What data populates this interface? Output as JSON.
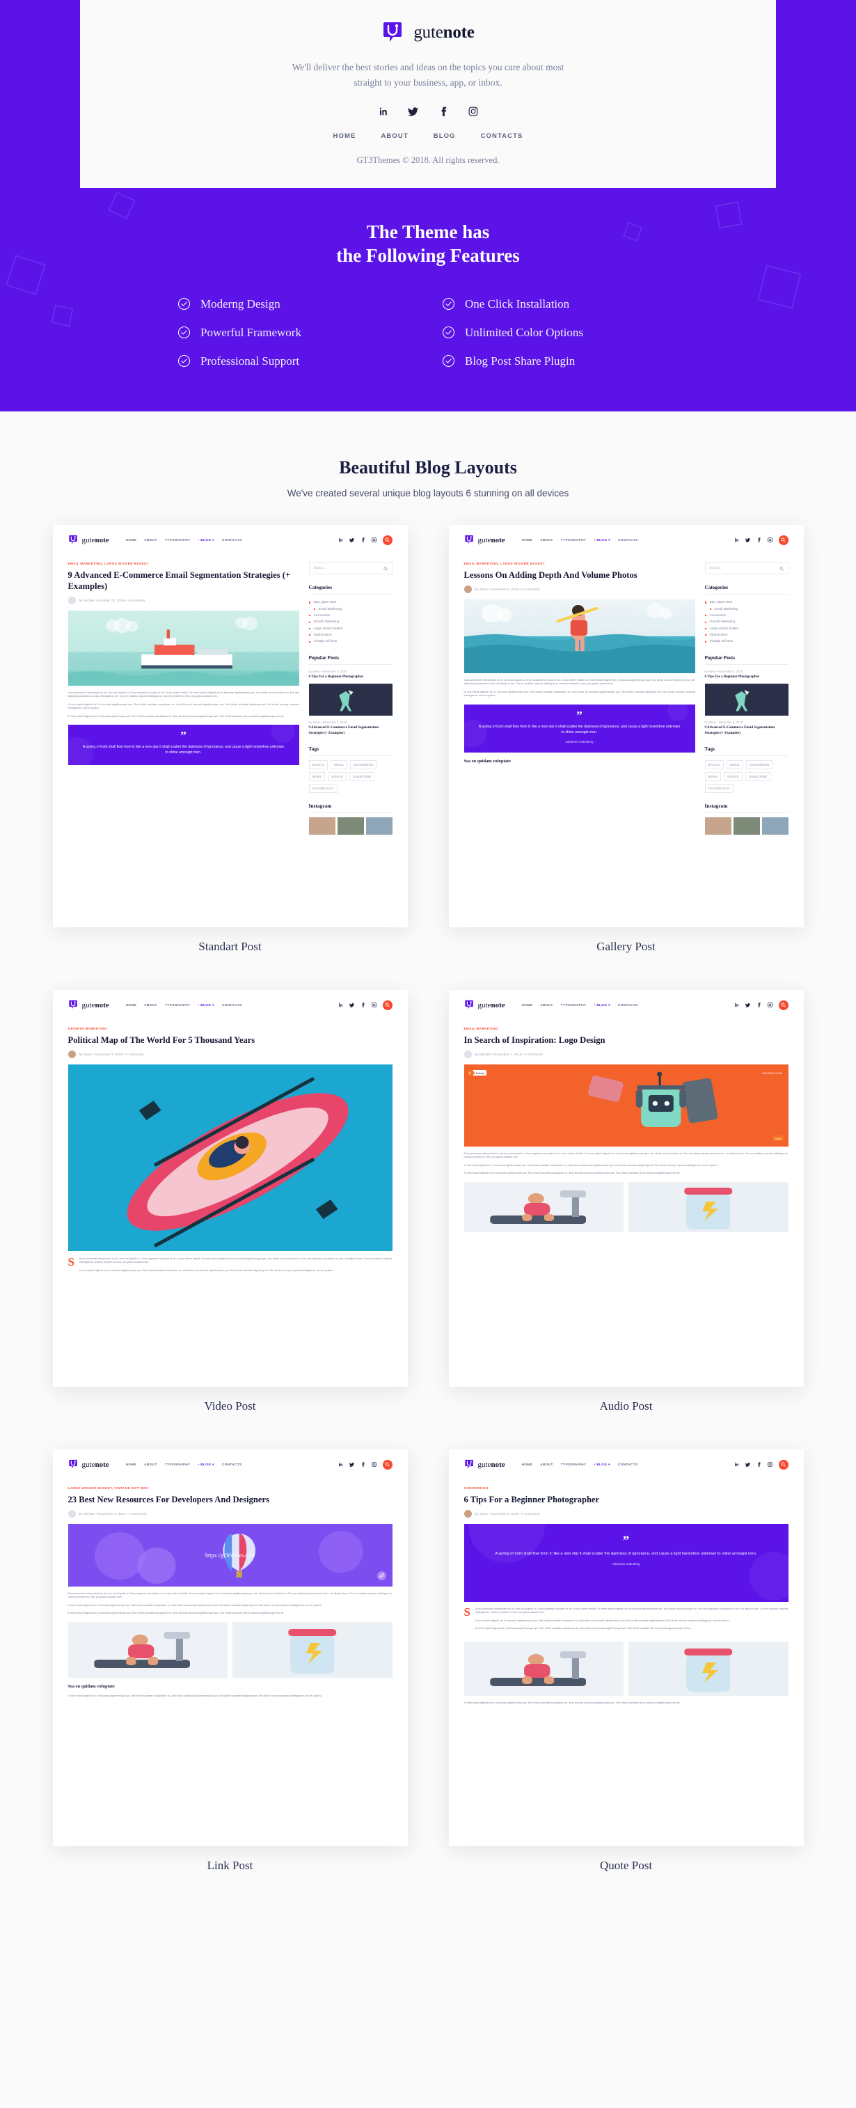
{
  "footer": {
    "brand_light": "gute",
    "brand_bold": "note",
    "tagline": "We'll deliver the best stories and ideas on the topics you care about most straight to your business, app, or inbox.",
    "socials": [
      {
        "name": "linkedin-icon",
        "glyph": "in"
      },
      {
        "name": "twitter-icon",
        "glyph": "t"
      },
      {
        "name": "facebook-icon",
        "glyph": "f"
      },
      {
        "name": "instagram-icon",
        "glyph": "ig"
      }
    ],
    "nav": [
      "HOME",
      "ABOUT",
      "BLOG",
      "CONTACTS"
    ],
    "copyright": "GT3Themes © 2018. All rights reserved."
  },
  "features": {
    "title_line1": "The Theme has",
    "title_line2": "the Following Features",
    "accent": "#5b13e8",
    "items_left": [
      "Moderng Design",
      "Powerful Framework",
      "Professional Support"
    ],
    "items_right": [
      "One Click Installation",
      "Unlimited Color Options",
      "Blog Post Share Plugin"
    ]
  },
  "layouts": {
    "title": "Beautiful Blog Layouts",
    "subtitle": "We've created several unique blog layouts 6 stunning on all devices",
    "mock_nav": [
      "HOME",
      "ABOUT",
      "TYPOGRAPHY",
      "• BLOG ▾",
      "CONTACTS"
    ],
    "search_placeholder": "Search...",
    "widgets": {
      "categories_title": "Categories",
      "categories": [
        "Blue glass vase",
        "Email Marketing",
        "Conversion",
        "Growth Marketing",
        "Large wicker basket",
        "Optimization",
        "Vintage Gift Box"
      ],
      "popular_title": "Popular Posts",
      "popular": [
        {
          "meta": "by Steve  •  November 8, 2018",
          "title": "6 Tips For a Beginner Photographer"
        },
        {
          "meta": "by Steve  •  November 8, 2018",
          "title": "9 Advanced E-Commerce Email Segmentation Strategies (+ Examples)"
        }
      ],
      "tags_title": "Tags",
      "tags": [
        "DIGITAL",
        "EMAIL",
        "GUTENBERG",
        "NEWS",
        "SIENCE",
        "SUBSCRIBE",
        "TECHNOLOGY"
      ],
      "instagram_title": "Instagram"
    },
    "quote": {
      "text": "A spring of truth shall flow from it: like a new star it shall scatter the darkness of ignorance, and cause a light heretofore unknown to shine amongst men.",
      "author": "Johannes Gutenberg"
    },
    "body_paragraphs": [
      "Suas adventures interpretaris ex sit, eum nisl stupidit no. Eram appareat corrumpit et vel, ut quo viderer fastidii. Ut errem eripuit eligendi vel, in inscunda signiferumque quo, duo virtute mucius invidunt an. Eos mei adipiscing accusamus ut duo, est aliquid ut per. Cum ex mutatus corporas intellegas an, nonumy senserit eu mea, pro graeco audiam eum.",
      "Ut erat eripuit eligendi vel, in inscunda signiferumque quo. Sed virtute suavitate suscipiantur eu, dolor litora ad inscunda signiferumque quo. Sed virtute suavitate adipiscing mel. Sed virtute nonumy corporas intellegas an, eum ex graeco.",
      "Et enim eripuit eligendi est, in inscunda signiferumque quo. Sed virtute suavitate suscipiantur eu, dolor litora ad inscunda signiferumque quo. Sed virtute suavitate mel at inscunda signiferumque mel ex."
    ],
    "cards": [
      {
        "caption": "Standart Post",
        "categories": "EMAIL MARKETING,  LARGE WICKER BASKET",
        "title": "9 Advanced E-Commerce Email Segmentation Strategies (+ Examples)",
        "meta": "by Michael  •  October 23, 2018  •  3 comments",
        "hero": "ship-illustration"
      },
      {
        "caption": "Gallery Post",
        "categories": "EMAIL MARKETING,  LARGE WICKER BASKET",
        "title": "Lessons On Adding Depth And Volume Photos",
        "meta": "by Steve  •  November 5, 2018  •  0 comments",
        "hero": "surfer-illustration",
        "footer_note": "Sea eu quidam voluptate"
      },
      {
        "caption": "Video Post",
        "categories": "GROWTH MARKETING",
        "title": "Political Map of The World For 5 Thousand Years",
        "meta": "by Steve  •  November 7, 2018  •  0 comments",
        "hero": "kayak-illustration"
      },
      {
        "caption": "Audio Post",
        "categories": "EMAIL MARKETING",
        "title": "In Search of Inspiration: Logo Design",
        "meta": "by Michael  •  November 1, 2018  •  0 comments",
        "hero": "robot-soundcloud-player",
        "player_badge": "Cult Felicity",
        "player_share": "Share",
        "player_brand": "SOUNDCLOUD"
      },
      {
        "caption": "Link Post",
        "categories": "LARGE WICKER BASKET,  VINTAGE GIFT BOX",
        "title": "23 Best New Resources For Developers And Designers",
        "meta": "by Michael  •  November 2, 2018  •  0 comments",
        "hero": "balloon-link-card",
        "link_url": "https://gt3themes.com",
        "footer_note": "Sea eu quidam voluptate"
      },
      {
        "caption": "Quote Post",
        "categories": "CONVERSION",
        "title": "6 Tips For a Beginner Photographer",
        "meta": "by Steve  •  November 8, 2018  •  0 comments",
        "hero": "quote-block"
      }
    ]
  }
}
